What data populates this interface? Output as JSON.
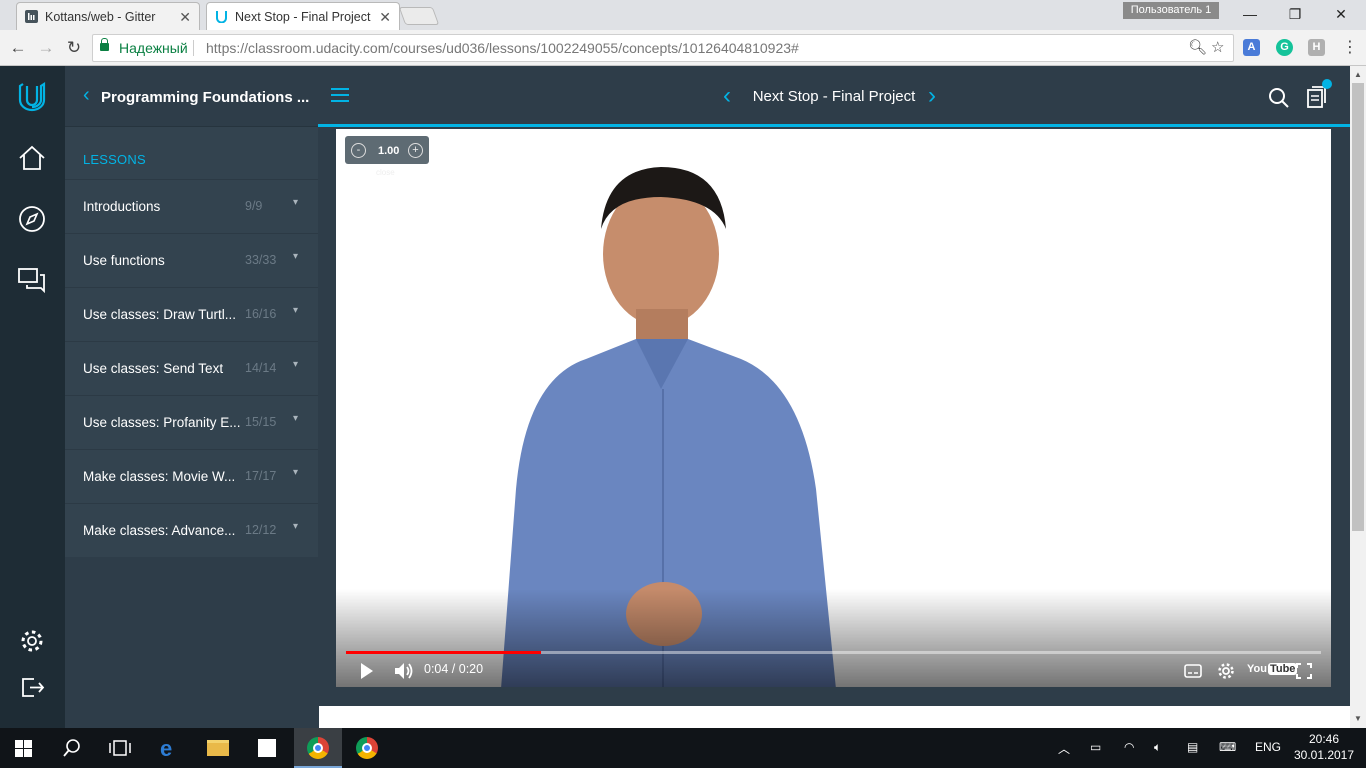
{
  "browser": {
    "tabs": [
      {
        "title": "Kottans/web - Gitter",
        "active": false
      },
      {
        "title": "Next Stop - Final Project",
        "active": true
      }
    ],
    "profile_name": "Пользователь 1",
    "secure_label": "Надежный",
    "url": "https://classroom.udacity.com/courses/ud036/lessons/1002249055/concepts/10126404810923#",
    "extensions": [
      {
        "name": "translate-extension-icon",
        "color": "#4a7bd8"
      },
      {
        "name": "grammarly-extension-icon",
        "color": "#15c39a",
        "label": "G"
      },
      {
        "name": "h-extension-icon",
        "color": "#b0b0b0",
        "label": "H"
      }
    ]
  },
  "sidebar": {
    "course_title": "Programming Foundations ...",
    "lessons_heading": "LESSONS",
    "lessons": [
      {
        "name": "Introductions",
        "count": "9/9"
      },
      {
        "name": "Use functions",
        "count": "33/33"
      },
      {
        "name": "Use classes: Draw Turtl...",
        "count": "16/16"
      },
      {
        "name": "Use classes: Send Text",
        "count": "14/14"
      },
      {
        "name": "Use classes: Profanity E...",
        "count": "15/15"
      },
      {
        "name": "Make classes: Movie W...",
        "count": "17/17"
      },
      {
        "name": "Make classes: Advance...",
        "count": "12/12"
      }
    ]
  },
  "header": {
    "concept_title": "Next Stop - Final Project"
  },
  "video": {
    "speed": "1.00",
    "speed_close": "close",
    "time": "0:04 / 0:20",
    "progress": 0.2,
    "youtube_label": "You"
  },
  "taskbar": {
    "language": "ENG",
    "time": "20:46",
    "date": "30.01.2017"
  },
  "colors": {
    "accent": "#02b3e4",
    "rail": "#1e2c35",
    "sidebar": "#2e3d49",
    "progress": "#ff0000"
  }
}
